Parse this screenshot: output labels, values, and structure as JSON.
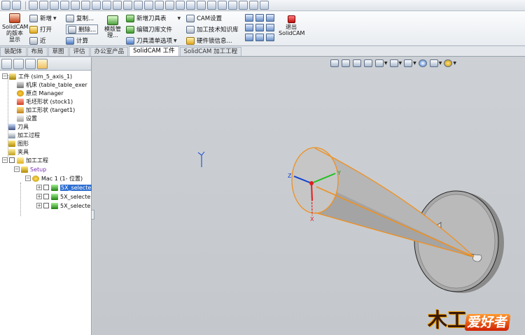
{
  "ribbon": {
    "display_ver": [
      "SolidCAM",
      "的版本",
      "显示"
    ],
    "new": "新增",
    "open": "打开",
    "recent": "近",
    "copy": "复制...",
    "delete": "删除...",
    "calc": "计算",
    "template": [
      "模版管",
      "理..."
    ],
    "new_tool_table": "新增刀具表",
    "edit_tool_file": "编辑刀库文件",
    "tool_list": "刀具清单选项",
    "cam_settings": "CAM设置",
    "machining_kb": "加工技术知识库",
    "hw_lock": "硬件锁信息...",
    "exit": [
      "退出",
      "SolidCAM"
    ]
  },
  "tabs": [
    {
      "label": "装配体",
      "active": false
    },
    {
      "label": "布局",
      "active": false
    },
    {
      "label": "草图",
      "active": false
    },
    {
      "label": "评估",
      "active": false
    },
    {
      "label": "办公室产品",
      "active": false
    },
    {
      "label": "SolidCAM 工件",
      "active": true
    },
    {
      "label": "SolidCAM 加工工程",
      "active": false
    }
  ],
  "tree": {
    "part": "工件 (sim_5_axis_1)",
    "machine": "机床 (table_table_exer",
    "origin": "原点 Manager",
    "stock": "毛坯形状 (stock1)",
    "target": "加工形状 (target1)",
    "settings": "设置",
    "tools": "刀具",
    "process": "加工过程",
    "geometry": "图形",
    "fixture": "夹具",
    "operations": "加工工程",
    "setup": "Setup",
    "mac": "Mac 1 (1- 位置)",
    "ops": [
      "5X_selecte",
      "5X_selecte",
      "5X_selecte"
    ]
  },
  "axes": {
    "x": "X",
    "y": "Y",
    "z": "Z"
  },
  "logo": {
    "char": "木工",
    "text": "爱好者"
  },
  "colors": {
    "model_edge": "#f09020",
    "model_fill": "#b8b8b8",
    "axis_x": "#e02020",
    "axis_y": "#20c020",
    "axis_z": "#1040d0"
  }
}
